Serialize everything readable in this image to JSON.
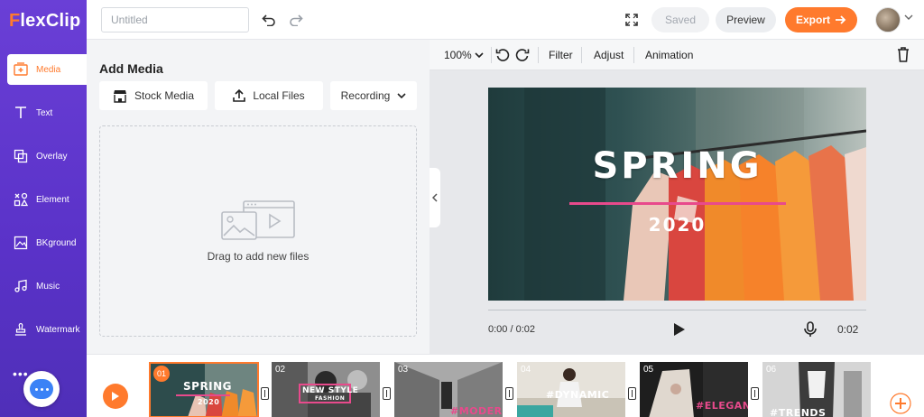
{
  "brand": {
    "logo_prefix": "F",
    "logo_rest": "lexClip",
    "accent": "#ff7a2d",
    "sidebar_color": "#5f36cf"
  },
  "sidebar": {
    "items": [
      {
        "label": "Media",
        "icon": "media-add-icon",
        "active": true
      },
      {
        "label": "Text",
        "icon": "text-icon"
      },
      {
        "label": "Overlay",
        "icon": "overlay-icon"
      },
      {
        "label": "Element",
        "icon": "element-icon"
      },
      {
        "label": "BKground",
        "icon": "background-icon"
      },
      {
        "label": "Music",
        "icon": "music-icon"
      },
      {
        "label": "Watermark",
        "icon": "watermark-icon"
      }
    ],
    "more": "•••"
  },
  "header": {
    "title_placeholder": "Untitled",
    "saved_label": "Saved",
    "preview_label": "Preview",
    "export_label": "Export"
  },
  "media_panel": {
    "title": "Add Media",
    "sources": [
      {
        "label": "Stock Media",
        "icon": "store-icon"
      },
      {
        "label": "Local Files",
        "icon": "upload-icon"
      },
      {
        "label": "Recording",
        "icon": "chevron-down-icon"
      }
    ],
    "drop_text": "Drag to add new files"
  },
  "toolbar": {
    "zoom": "100%",
    "filter": "Filter",
    "adjust": "Adjust",
    "animation": "Animation"
  },
  "canvas": {
    "title": "SPRING",
    "subtitle": "2020",
    "line_color": "#e84a8c"
  },
  "player": {
    "current": "0:00 / 0:02",
    "duration": "0:02"
  },
  "timeline": {
    "scenes": [
      {
        "num": "01",
        "label": "SPRING",
        "sub": "2020",
        "selected": true
      },
      {
        "num": "02",
        "label": "NEW STYLE",
        "sub": "FASHION"
      },
      {
        "num": "03",
        "label": "#MODERN"
      },
      {
        "num": "04",
        "label": "#DYNAMIC"
      },
      {
        "num": "05",
        "label": "#ELEGANT"
      },
      {
        "num": "06",
        "label": "#TRENDS"
      }
    ]
  }
}
